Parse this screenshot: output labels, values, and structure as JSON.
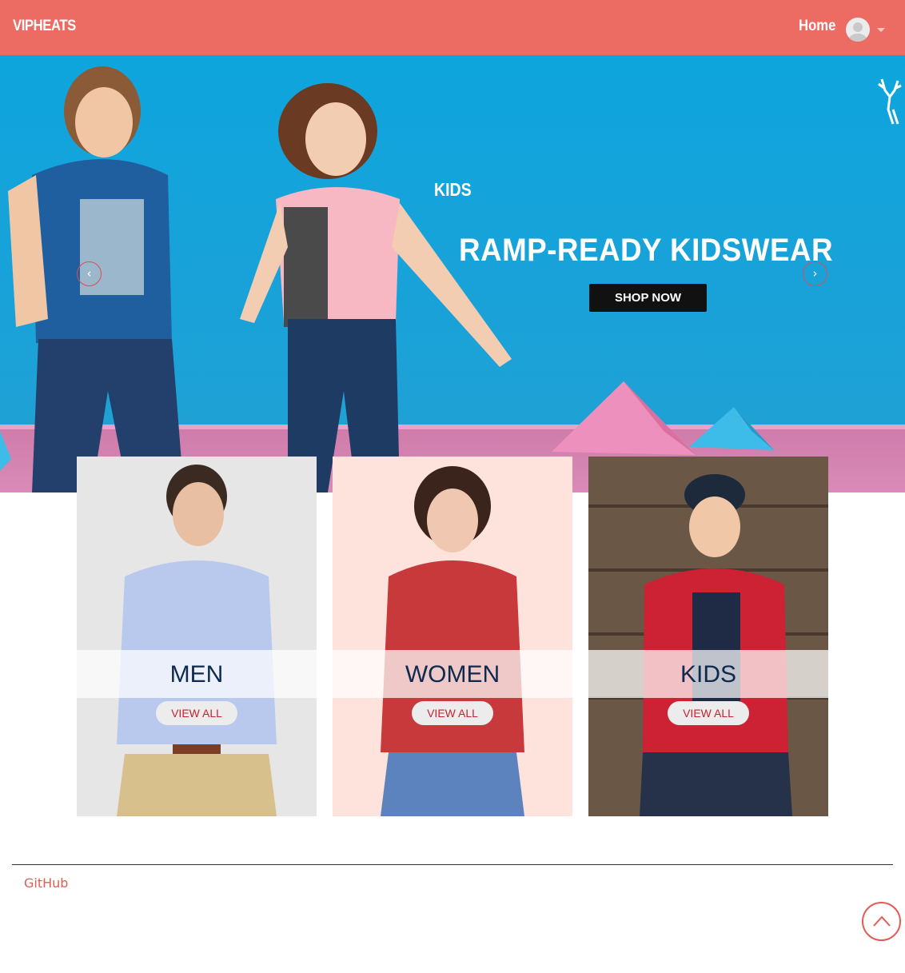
{
  "navbar": {
    "brand": "VIPHEATS",
    "home": "Home",
    "avatar_icon": "user-avatar-icon",
    "dropdown_icon": "caret-down-icon"
  },
  "carousel": {
    "caption": "KIDS",
    "headline": "RAMP-READY KIDSWEAR",
    "cta": "SHOP NOW",
    "prev_icon": "chevron-left-icon",
    "next_icon": "chevron-right-icon",
    "prev_glyph": "‹",
    "next_glyph": "›"
  },
  "categories": [
    {
      "title": "MEN",
      "button": "VIEW ALL"
    },
    {
      "title": "WOMEN",
      "button": "VIEW ALL"
    },
    {
      "title": "KIDS",
      "button": "VIEW ALL"
    }
  ],
  "footer": {
    "link": "GitHub",
    "to_top_icon": "chevron-up-icon"
  },
  "colors": {
    "brand": "#ec6b63",
    "accent_text": "#e25c53",
    "title_navy": "#0e2a4f",
    "button_red_text": "#c4252d"
  }
}
